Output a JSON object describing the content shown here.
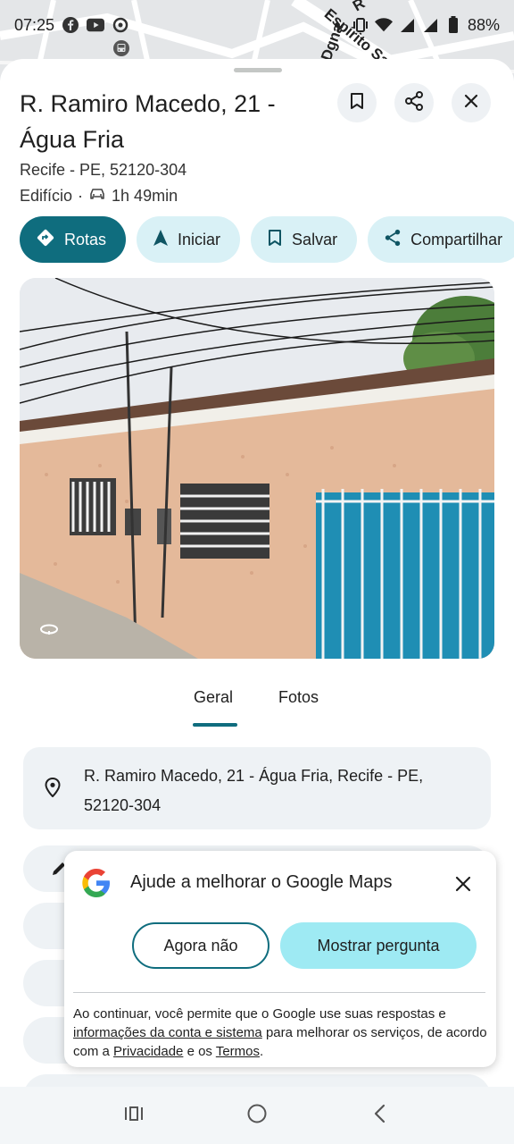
{
  "status_bar": {
    "time": "07:25",
    "battery": "88%",
    "notification_icons": [
      "facebook-icon",
      "youtube-icon",
      "maps-icon",
      "bus-icon"
    ]
  },
  "map": {
    "road_label_1": "Espírito Sant",
    "road_label_2": "Dgna",
    "road_label_3": "R"
  },
  "place": {
    "title": "R. Ramiro Macedo, 21 - Água Fria",
    "city_line": "Recife - PE, 52120-304",
    "category": "Edifício",
    "separator": "·",
    "drive_time": "1h 49min"
  },
  "actions": [
    {
      "label": "Rotas",
      "icon": "directions-icon"
    },
    {
      "label": "Iniciar",
      "icon": "navigation-arrow-icon"
    },
    {
      "label": "Salvar",
      "icon": "bookmark-icon"
    },
    {
      "label": "Compartilhar",
      "icon": "share-icon"
    }
  ],
  "tabs": [
    {
      "label": "Geral",
      "selected": true
    },
    {
      "label": "Fotos",
      "selected": false
    }
  ],
  "address_card": {
    "text": "R. Ramiro Macedo, 21 - Água Fria, Recife - PE, 52120-304"
  },
  "popup": {
    "title": "Ajude a melhorar o Google Maps",
    "dismiss_label": "Agora não",
    "confirm_label": "Mostrar pergunta",
    "legal_1": "Ao continuar, você permite que o Google use suas respostas e ",
    "legal_link_1": "informações da conta e sistema",
    "legal_2": " para melhorar os serviços, de acordo com a ",
    "legal_link_2": "Privacidade",
    "legal_3": " e os ",
    "legal_link_3": "Termos",
    "legal_4": "."
  },
  "colors": {
    "accent": "#0f6d7e",
    "chip_bg": "#d9f1f6",
    "confirm_bg": "#9eeaf3"
  }
}
